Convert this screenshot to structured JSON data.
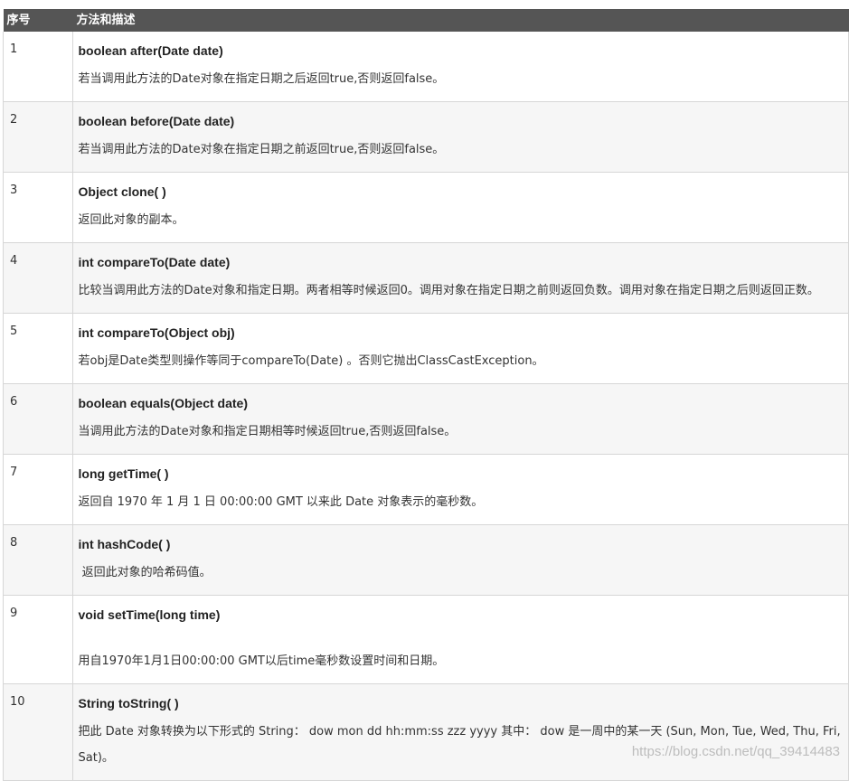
{
  "header": {
    "col_num": "序号",
    "col_desc": "方法和描述"
  },
  "rows": [
    {
      "num": "1",
      "method": "boolean after(Date date)",
      "desc": "若当调用此方法的Date对象在指定日期之后返回true,否则返回false。"
    },
    {
      "num": "2",
      "method": "boolean before(Date date)",
      "desc": "若当调用此方法的Date对象在指定日期之前返回true,否则返回false。"
    },
    {
      "num": "3",
      "method": "Object clone( )",
      "desc": "返回此对象的副本。"
    },
    {
      "num": "4",
      "method": "int compareTo(Date date)",
      "desc": "比较当调用此方法的Date对象和指定日期。两者相等时候返回0。调用对象在指定日期之前则返回负数。调用对象在指定日期之后则返回正数。"
    },
    {
      "num": "5",
      "method": "int compareTo(Object obj)",
      "desc": "若obj是Date类型则操作等同于compareTo(Date) 。否则它抛出ClassCastException。"
    },
    {
      "num": "6",
      "method": "boolean equals(Object date)",
      "desc": "当调用此方法的Date对象和指定日期相等时候返回true,否则返回false。"
    },
    {
      "num": "7",
      "method": "long getTime( )",
      "desc": "返回自 1970 年 1 月 1 日 00:00:00 GMT 以来此 Date 对象表示的毫秒数。"
    },
    {
      "num": "8",
      "method": "int hashCode( )",
      "desc": " 返回此对象的哈希码值。"
    },
    {
      "num": "9",
      "method": "void setTime(long time)",
      "desc": "用自1970年1月1日00:00:00 GMT以后time毫秒数设置时间和日期。"
    },
    {
      "num": "10",
      "method": "String toString( )",
      "desc": "把此 Date 对象转换为以下形式的 String： dow mon dd hh:mm:ss zzz yyyy 其中： dow 是一周中的某一天 (Sun, Mon, Tue, Wed, Thu, Fri, Sat)。"
    }
  ],
  "watermark": "https://blog.csdn.net/qq_39414483"
}
